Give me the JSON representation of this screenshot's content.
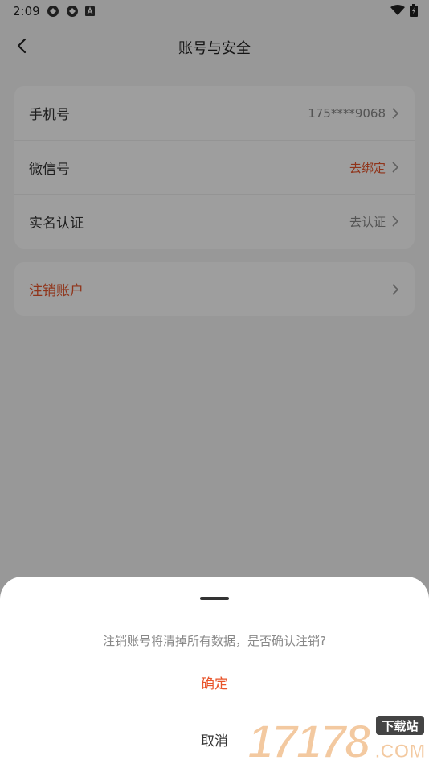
{
  "status_bar": {
    "time": "2:09",
    "left_icons": [
      "notification-icon",
      "notification-icon",
      "a-icon"
    ],
    "right_icons": [
      "wifi-icon",
      "battery-icon"
    ]
  },
  "nav": {
    "title": "账号与安全",
    "back_icon": "chevron-left-icon"
  },
  "account_rows": [
    {
      "label": "手机号",
      "value": "175****9068"
    },
    {
      "label": "微信号",
      "value": "去绑定"
    },
    {
      "label": "实名认证",
      "value": "去认证"
    }
  ],
  "delete_row": {
    "label": "注销账户"
  },
  "dialog": {
    "message": "注销账号将清掉所有数据，是否确认注销?",
    "confirm_label": "确定",
    "cancel_label": "取消"
  },
  "watermark": {
    "number": "17178",
    "site_text": "下载站",
    "domain_text": ".COM"
  },
  "colors": {
    "accent": "#e8542a",
    "background": "#f6f6f6",
    "card": "#ffffff",
    "overlay": "rgba(0,0,0,0.38)"
  }
}
